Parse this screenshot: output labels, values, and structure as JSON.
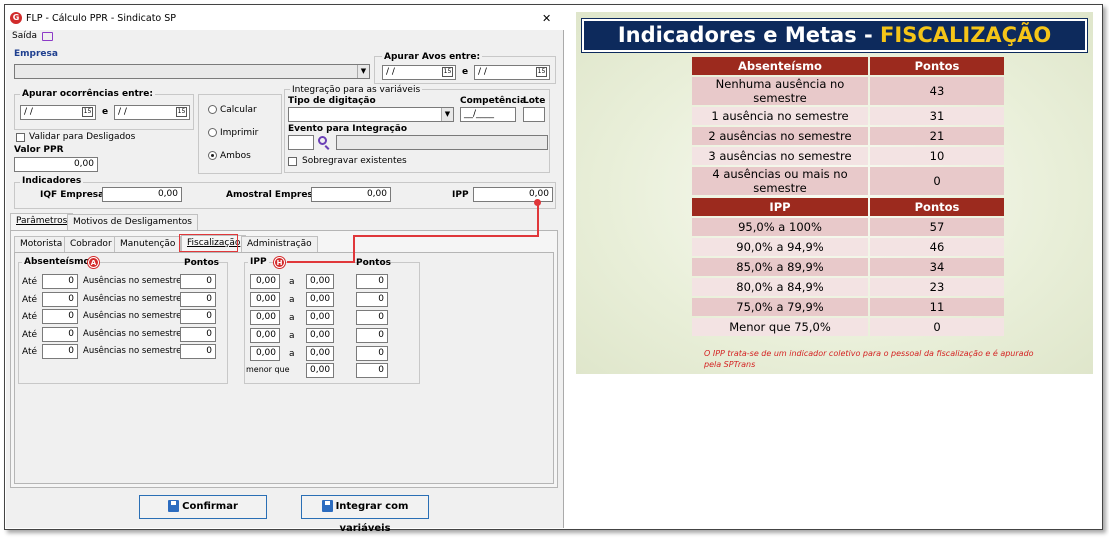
{
  "window": {
    "title": "FLP - Cálculo PPR - Sindicato SP",
    "menu_saida": "Saída",
    "close_glyph": "✕"
  },
  "empresa": {
    "label": "Empresa",
    "value": ""
  },
  "apurar_avos": {
    "label": "Apurar Avos entre:",
    "from": "/ /",
    "conj": "e",
    "to": "/ /"
  },
  "apurar_ocorrencias": {
    "label": "Apurar ocorrências entre:",
    "from": "/ /",
    "conj": "e",
    "to": "/ /"
  },
  "modo": {
    "options": [
      "Calcular",
      "Imprimir",
      "Ambos"
    ],
    "selected": "Ambos"
  },
  "integracao": {
    "label": "Integração para as variáveis",
    "tipo_digitacao": "Tipo de digitação",
    "competencia": "Competência",
    "competencia_value": "__/____",
    "lote": "Lote",
    "evento": "Evento para Integração",
    "sobregravar": "Sobregravar existentes"
  },
  "validar_desligados": "Validar para Desligados",
  "valor_ppr": {
    "label": "Valor PPR",
    "value": "0,00"
  },
  "indicadores": {
    "label": "Indicadores",
    "iqf_label": "IQF Empresa",
    "iqf_value": "0,00",
    "amostral_label": "Amostral Empresa",
    "amostral_value": "0,00",
    "ipp_label": "IPP",
    "ipp_value": "0,00"
  },
  "tabs_main": [
    "Parâmetros",
    "Motivos de Desligamentos"
  ],
  "tabs_sub": [
    "Motorista",
    "Cobrador",
    "Manutenção",
    "Fiscalização",
    "Administração"
  ],
  "absenteismo": {
    "title": "Absenteísmo",
    "pontos_label": "Pontos",
    "marker": "A",
    "rows": [
      {
        "prefix": "Até",
        "value": "0",
        "text": "Ausências no semestre",
        "pontos": "0"
      },
      {
        "prefix": "Até",
        "value": "0",
        "text": "Ausências no semestre",
        "pontos": "0"
      },
      {
        "prefix": "Até",
        "value": "0",
        "text": "Ausências no semestre",
        "pontos": "0"
      },
      {
        "prefix": "Até",
        "value": "0",
        "text": "Ausências no semestre",
        "pontos": "0"
      },
      {
        "prefix": "Até",
        "value": "0",
        "text": "Ausências no semestre",
        "pontos": "0"
      }
    ]
  },
  "ipp": {
    "title": "IPP",
    "pontos_label": "Pontos",
    "marker": "H",
    "rows": [
      {
        "from": "0,00",
        "sep": "a",
        "to": "0,00",
        "pontos": "0"
      },
      {
        "from": "0,00",
        "sep": "a",
        "to": "0,00",
        "pontos": "0"
      },
      {
        "from": "0,00",
        "sep": "a",
        "to": "0,00",
        "pontos": "0"
      },
      {
        "from": "0,00",
        "sep": "a",
        "to": "0,00",
        "pontos": "0"
      },
      {
        "from": "0,00",
        "sep": "a",
        "to": "0,00",
        "pontos": "0"
      }
    ],
    "menor_label": "menor que",
    "menor_value": "0,00",
    "menor_pontos": "0"
  },
  "buttons": {
    "confirmar": "Confirmar",
    "integrar": "Integrar com variáveis"
  },
  "slide": {
    "title_main": "Indicadores e Metas - ",
    "title_highlight": "FISCALIZAÇÃO",
    "table1": {
      "headers": [
        "Absenteísmo",
        "Pontos"
      ],
      "rows": [
        [
          "Nenhuma ausência no semestre",
          "43"
        ],
        [
          "1 ausência no semestre",
          "31"
        ],
        [
          "2 ausências no semestre",
          "21"
        ],
        [
          "3 ausências no semestre",
          "10"
        ],
        [
          "4 ausências ou mais no semestre",
          "0"
        ]
      ]
    },
    "table2": {
      "headers": [
        "IPP",
        "Pontos"
      ],
      "rows": [
        [
          "95,0% a 100%",
          "57"
        ],
        [
          "90,0% a 94,9%",
          "46"
        ],
        [
          "85,0% a 89,9%",
          "34"
        ],
        [
          "80,0% a 84,9%",
          "23"
        ],
        [
          "75,0% a 79,9%",
          "11"
        ],
        [
          "Menor que 75,0%",
          "0"
        ]
      ]
    },
    "note": "O IPP trata-se de um indicador coletivo para o pessoal da fiscalização e é apurado pela SPTrans"
  },
  "colors": {
    "accent_red": "#e0373a",
    "table_header": "#9c2a1e",
    "banner": "#0d2a5c",
    "highlight": "#f5c518"
  }
}
